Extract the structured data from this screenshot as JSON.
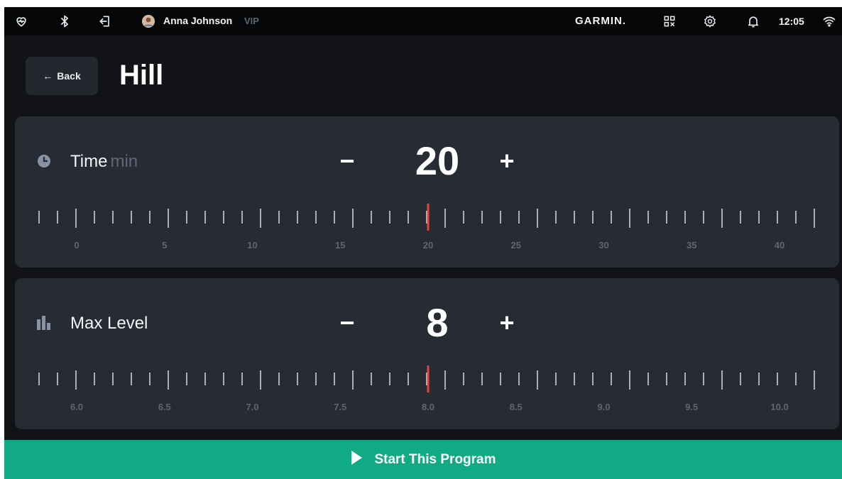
{
  "status_bar": {
    "user_name": "Anna Johnson",
    "user_badge": "VIP",
    "brand": "GARMIN.",
    "clock": "12:05",
    "icons": [
      "heart-rate-icon",
      "bluetooth-icon",
      "logout-icon",
      "qr-code-icon",
      "gear-icon",
      "bell-icon",
      "wifi-icon"
    ]
  },
  "header": {
    "back_label": "Back",
    "title": "Hill"
  },
  "time_setting": {
    "label": "Time",
    "unit": "min",
    "value": "20",
    "minus": "−",
    "plus": "+",
    "ruler": {
      "min": 0,
      "max": 40,
      "step": 1,
      "major_every": 5,
      "selected": 20,
      "labels": [
        "0",
        "5",
        "10",
        "15",
        "20",
        "25",
        "30",
        "35",
        "40"
      ]
    }
  },
  "level_setting": {
    "label": "Max Level",
    "value": "8",
    "minus": "−",
    "plus": "+",
    "ruler": {
      "min": 6.0,
      "max": 10.0,
      "step": 0.1,
      "major_every": 5,
      "selected": 8.0,
      "labels": [
        "6.0",
        "6.5",
        "7.0",
        "7.5",
        "8.0",
        "8.5",
        "9.0",
        "9.5",
        "10.0"
      ]
    }
  },
  "footer": {
    "start_label": "Start This Program"
  },
  "colors": {
    "accent": "#10ab85",
    "indicator": "#e0473c",
    "card": "#272c34",
    "background": "#111316"
  }
}
